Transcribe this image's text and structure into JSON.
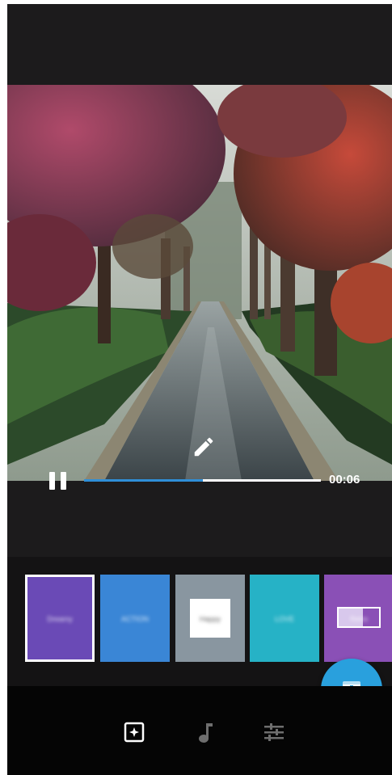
{
  "player": {
    "time": "00:06",
    "progress": 0.5
  },
  "icons": {
    "edit": "pencil-icon",
    "pause": "pause-icon",
    "export": "save-to-gallery-icon",
    "tab_themes": "photo-sparkle-icon",
    "tab_music": "music-note-icon",
    "tab_adjust": "sliders-icon"
  },
  "themes": [
    {
      "label": "Dreamy",
      "color": "#6a4ab6",
      "selected": true
    },
    {
      "label": "ACTION",
      "color": "#3a86d6",
      "selected": false
    },
    {
      "label": "Happy",
      "color": "#8996a0",
      "selected": false
    },
    {
      "label": "LOVE",
      "color": "#26b2c6",
      "selected": false
    },
    {
      "label": "Retro",
      "color": "#8a50b6",
      "selected": false
    }
  ],
  "colors": {
    "accent": "#29a0dd",
    "background": "#1c1b1c",
    "bottom_bar": "#050505"
  }
}
